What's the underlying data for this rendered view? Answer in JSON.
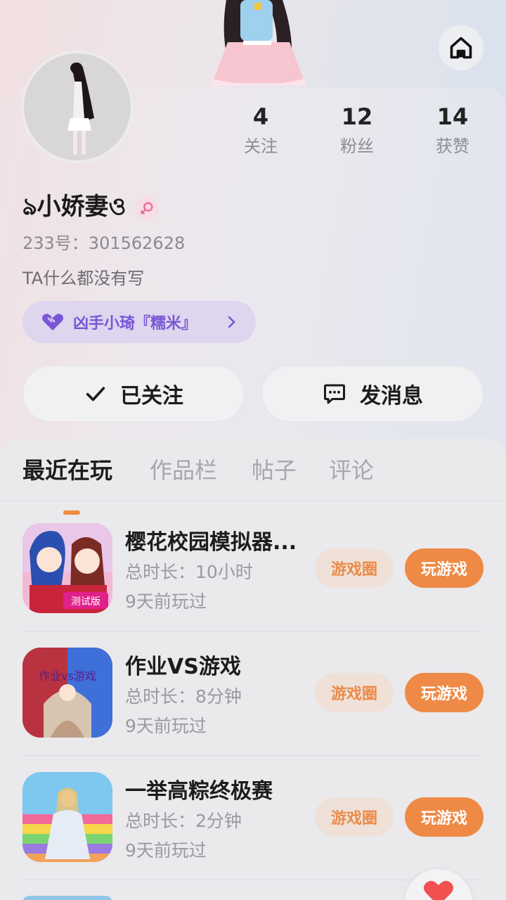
{
  "header": {
    "home_icon": "home-icon"
  },
  "profile": {
    "stats": [
      {
        "value": "4",
        "label": "关注"
      },
      {
        "value": "12",
        "label": "粉丝"
      },
      {
        "value": "14",
        "label": "获赞"
      }
    ],
    "name": "ঌ小娇妻ও",
    "gender_icon": "female-icon",
    "uid_text": "233号：301562628",
    "bio": "TA什么都没有写",
    "tag": {
      "icon": "purple-heart-icon",
      "label": "凶手小琦『糯米』"
    },
    "follow_button": "已关注",
    "message_button": "发消息"
  },
  "tabs": [
    {
      "label": "最近在玩",
      "active": true
    },
    {
      "label": "作品栏",
      "active": false
    },
    {
      "label": "帖子",
      "active": false
    },
    {
      "label": "评论",
      "active": false
    }
  ],
  "games": [
    {
      "title": "樱花校园模拟器...",
      "duration": "总时长：10小时",
      "last_played": "9天前玩过",
      "circle_label": "游戏圈",
      "play_label": "玩游戏",
      "icon_text": "测试版"
    },
    {
      "title": "作业VS游戏",
      "duration": "总时长：8分钟",
      "last_played": "9天前玩过",
      "circle_label": "游戏圈",
      "play_label": "玩游戏",
      "icon_text": "作业vs游戏"
    },
    {
      "title": "一举高粽终极赛",
      "duration": "总时长：2分钟",
      "last_played": "9天前玩过",
      "circle_label": "游戏圈",
      "play_label": "玩游戏"
    }
  ],
  "colors": {
    "accent": "#ee8a45",
    "accent_soft": "#efe1d8",
    "tag_text": "#7a56d6",
    "tag_bg": "#ddd6ee"
  }
}
